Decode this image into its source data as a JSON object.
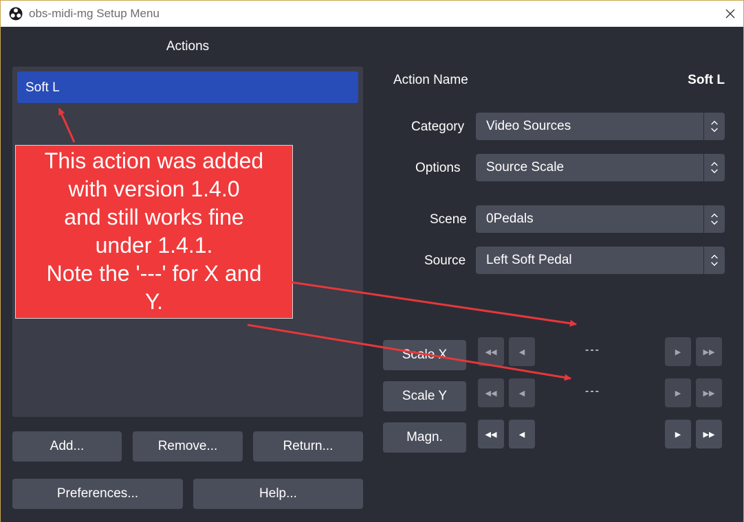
{
  "window": {
    "title": "obs-midi-mg Setup Menu",
    "icon": "obs-logo-icon",
    "close_icon": "close-icon"
  },
  "actions_panel": {
    "heading": "Actions",
    "items": [
      {
        "label": "Soft L",
        "selected": true
      }
    ]
  },
  "buttons": {
    "add": "Add...",
    "remove": "Remove...",
    "return": "Return...",
    "preferences": "Preferences...",
    "help": "Help..."
  },
  "detail": {
    "action_name_label": "Action Name",
    "action_name_value": "Soft L",
    "category_label": "Category",
    "category_value": "Video Sources",
    "options_label": "Options",
    "options_value": "Source Scale",
    "scene_label": "Scene",
    "scene_value": "0Pedals",
    "source_label": "Source",
    "source_value": "Left Soft Pedal"
  },
  "scale_rows": [
    {
      "label": "Scale X",
      "value": "---"
    },
    {
      "label": "Scale Y",
      "value": "---"
    },
    {
      "label": "Magn.",
      "value": ""
    }
  ],
  "annotation": {
    "lines": [
      "This action was added",
      "with version 1.4.0",
      "and still works fine",
      "under 1.4.1.",
      "Note the '---' for X and",
      "Y."
    ]
  },
  "colors": {
    "background": "#2b2d36",
    "panel": "#3b3d49",
    "control": "#4a4e5a",
    "selection": "#284cb8",
    "annotation": "#f0393b"
  }
}
